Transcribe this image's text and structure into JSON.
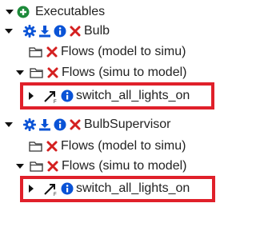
{
  "tree": {
    "root_label": "Executables",
    "nodes": [
      {
        "label": "Bulb",
        "folders": [
          {
            "label": "Flows (model to simu)"
          },
          {
            "label": "Flows (simu to model)"
          }
        ],
        "flow_item": "switch_all_lights_on"
      },
      {
        "label": "BulbSupervisor",
        "folders": [
          {
            "label": "Flows (model to simu)"
          },
          {
            "label": "Flows (simu to model)"
          }
        ],
        "flow_item": "switch_all_lights_on"
      }
    ]
  },
  "colors": {
    "icon_blue": "#0a53d6",
    "delete_red": "#d42020",
    "add_green": "#1d8a3a",
    "highlight_red": "#e0202a"
  }
}
